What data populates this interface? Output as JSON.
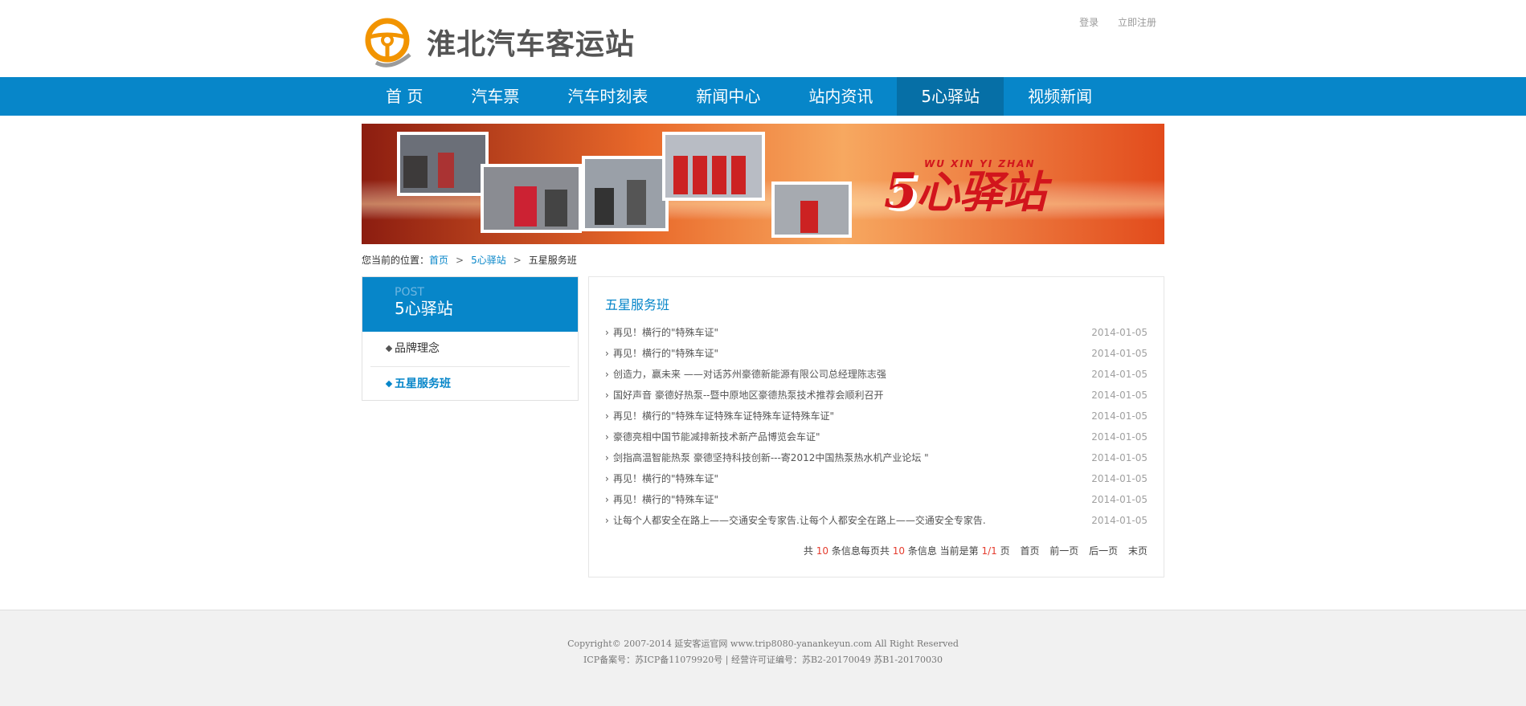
{
  "header": {
    "logo_text": "淮北汽车客运站",
    "login_label": "登录",
    "register_label": "立即注册"
  },
  "nav": {
    "items": [
      {
        "label": "首 页"
      },
      {
        "label": "汽车票"
      },
      {
        "label": "汽车时刻表"
      },
      {
        "label": "新闻中心"
      },
      {
        "label": "站内资讯"
      },
      {
        "label": "5心驿站"
      },
      {
        "label": "视频新闻"
      }
    ],
    "active_index": 5
  },
  "banner": {
    "title": "5心驿站",
    "pinyin": "WU XIN YI ZHAN"
  },
  "breadcrumb": {
    "prefix": "您当前的位置：",
    "home": "首页",
    "section": "5心驿站",
    "current": "五星服务班",
    "separator": ">"
  },
  "sidebar": {
    "en_title": "POST",
    "cn_title": "5心驿站",
    "items": [
      {
        "label": "品牌理念"
      },
      {
        "label": "五星服务班"
      }
    ]
  },
  "main": {
    "title": "五星服务班",
    "arrow": "›",
    "list": [
      {
        "title": "再见！横行的\"特殊车证\"",
        "date": "2014-01-05"
      },
      {
        "title": "再见！横行的\"特殊车证\"",
        "date": "2014-01-05"
      },
      {
        "title": "创造力，赢未来 ——对话苏州豪德新能源有限公司总经理陈志强",
        "date": "2014-01-05"
      },
      {
        "title": "国好声音 豪德好热泵--暨中原地区豪德热泵技术推荐会顺利召开",
        "date": "2014-01-05"
      },
      {
        "title": "再见！横行的\"特殊车证特殊车证特殊车证特殊车证\"",
        "date": "2014-01-05"
      },
      {
        "title": "豪德亮相中国节能减排新技术新产品博览会车证\"",
        "date": "2014-01-05"
      },
      {
        "title": "剑指高温智能热泵 豪德坚持科技创新---寄2012中国热泵热水机产业论坛 \"",
        "date": "2014-01-05"
      },
      {
        "title": "再见！横行的\"特殊车证\"",
        "date": "2014-01-05"
      },
      {
        "title": "再见！横行的\"特殊车证\"",
        "date": "2014-01-05"
      },
      {
        "title": "让每个人都安全在路上——交通安全专家告.让每个人都安全在路上——交通安全专家告.",
        "date": "2014-01-05"
      }
    ]
  },
  "pager": {
    "t1": "共",
    "total": "10",
    "t2": "条信息每页共",
    "per_page": "10",
    "t3": "条信息 当前是第",
    "page": "1/1",
    "t4": "页",
    "first": "首页",
    "prev": "前一页",
    "next": "后一页",
    "last": "末页"
  },
  "footer": {
    "line1": "Copyright© 2007-2014 延安客运官网 www.trip8080-yanankeyun.com All Right Reserved",
    "line2": "ICP备案号：苏ICP备11079920号 | 经营许可证编号：苏B2-20170049 苏B1-20170030"
  },
  "colors": {
    "brand_blue": "#0786c9",
    "nav_active": "#066fa6",
    "logo_orange": "#f29400",
    "accent_red": "#e53d2f"
  }
}
